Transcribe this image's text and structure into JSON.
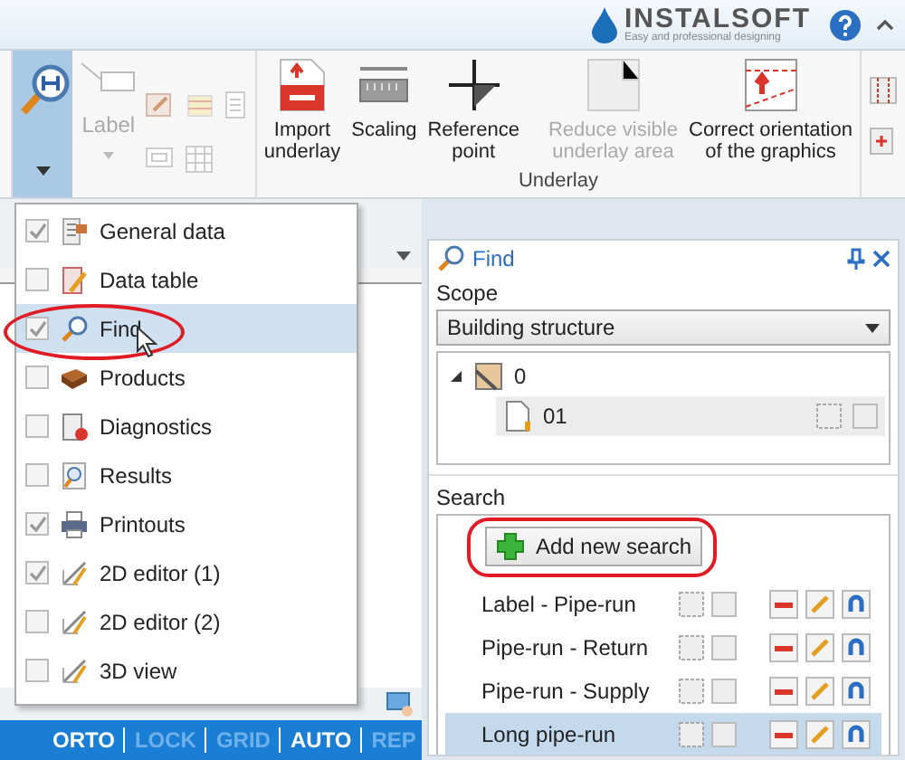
{
  "header": {
    "brand": "INSTALSOFT",
    "tagline": "Easy and professional designing"
  },
  "ribbon": {
    "find_button": {
      "selected": true
    },
    "label_tool": {
      "label": "Label",
      "disabled": true
    },
    "underlay_group": {
      "title": "Underlay",
      "buttons": [
        {
          "kind": "import",
          "lines": [
            "Import",
            "underlay"
          ],
          "disabled": false
        },
        {
          "kind": "scaling",
          "lines": [
            "Scaling"
          ],
          "disabled": false
        },
        {
          "kind": "reference",
          "lines": [
            "Reference",
            "point"
          ],
          "disabled": false
        },
        {
          "kind": "reduce",
          "lines": [
            "Reduce visible",
            "underlay area"
          ],
          "disabled": true
        },
        {
          "kind": "orientation",
          "lines": [
            "Correct orientation",
            "of the graphics"
          ],
          "disabled": false
        }
      ]
    }
  },
  "panels_menu": {
    "items": [
      {
        "kind": "general",
        "label": "General data",
        "checked": true,
        "selected": false
      },
      {
        "kind": "table",
        "label": "Data table",
        "checked": false,
        "selected": false
      },
      {
        "kind": "find",
        "label": "Find",
        "checked": true,
        "selected": true
      },
      {
        "kind": "products",
        "label": "Products",
        "checked": false,
        "selected": false
      },
      {
        "kind": "diagnostics",
        "label": "Diagnostics",
        "checked": false,
        "selected": false
      },
      {
        "kind": "results",
        "label": "Results",
        "checked": false,
        "selected": false
      },
      {
        "kind": "printouts",
        "label": "Printouts",
        "checked": true,
        "selected": false
      },
      {
        "kind": "editor",
        "label": "2D editor (1)",
        "checked": true,
        "selected": false
      },
      {
        "kind": "editor",
        "label": "2D editor (2)",
        "checked": false,
        "selected": false
      },
      {
        "kind": "editor",
        "label": "3D view",
        "checked": false,
        "selected": false
      }
    ]
  },
  "status_bar": {
    "items": [
      {
        "label": "ORTO",
        "on": true
      },
      {
        "label": "LOCK",
        "on": false
      },
      {
        "label": "GRID",
        "on": false
      },
      {
        "label": "AUTO",
        "on": true
      },
      {
        "label": "REP",
        "on": false
      }
    ]
  },
  "find_panel": {
    "title": "Find",
    "scope_label": "Scope",
    "scope_value": "Building structure",
    "tree": [
      {
        "label": "0",
        "expanded": true,
        "selected": false,
        "children": [
          {
            "label": "01",
            "selected": true
          }
        ]
      }
    ],
    "search_label": "Search",
    "add_button": "Add new search",
    "searches": [
      {
        "label": "Label - Pipe-run",
        "selected": false
      },
      {
        "label": "Pipe-run - Return",
        "selected": false
      },
      {
        "label": "Pipe-run - Supply",
        "selected": false
      },
      {
        "label": "Long pipe-run",
        "selected": true
      }
    ]
  }
}
